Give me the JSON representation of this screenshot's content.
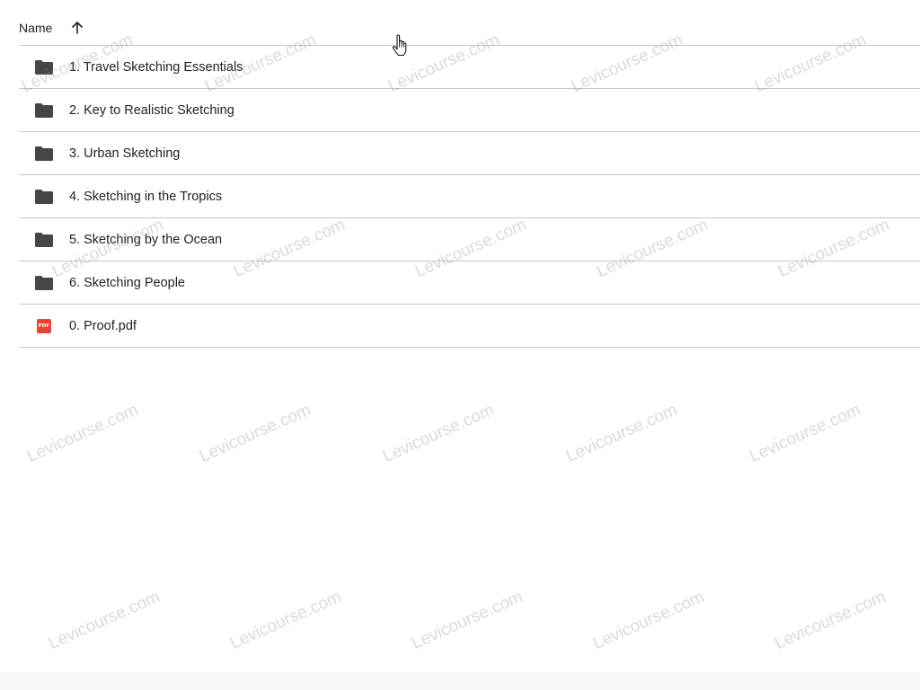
{
  "header": {
    "name_label": "Name",
    "sort_icon": "arrow-up-icon"
  },
  "items": [
    {
      "icon": "folder-icon",
      "label": "1. Travel Sketching Essentials"
    },
    {
      "icon": "folder-icon",
      "label": "2. Key to Realistic Sketching"
    },
    {
      "icon": "folder-icon",
      "label": "3. Urban Sketching"
    },
    {
      "icon": "folder-icon",
      "label": "4. Sketching in the Tropics"
    },
    {
      "icon": "folder-icon",
      "label": "5. Sketching by the Ocean"
    },
    {
      "icon": "folder-icon",
      "label": "6. Sketching People"
    },
    {
      "icon": "pdf-icon",
      "label": "0. Proof.pdf",
      "badge": "PDF"
    }
  ],
  "watermark": {
    "text": "Levicourse.com"
  },
  "colors": {
    "folder": "#444746",
    "pdf": "#ea4335",
    "divider": "#c7c7c7",
    "text": "#1f1f1f"
  }
}
